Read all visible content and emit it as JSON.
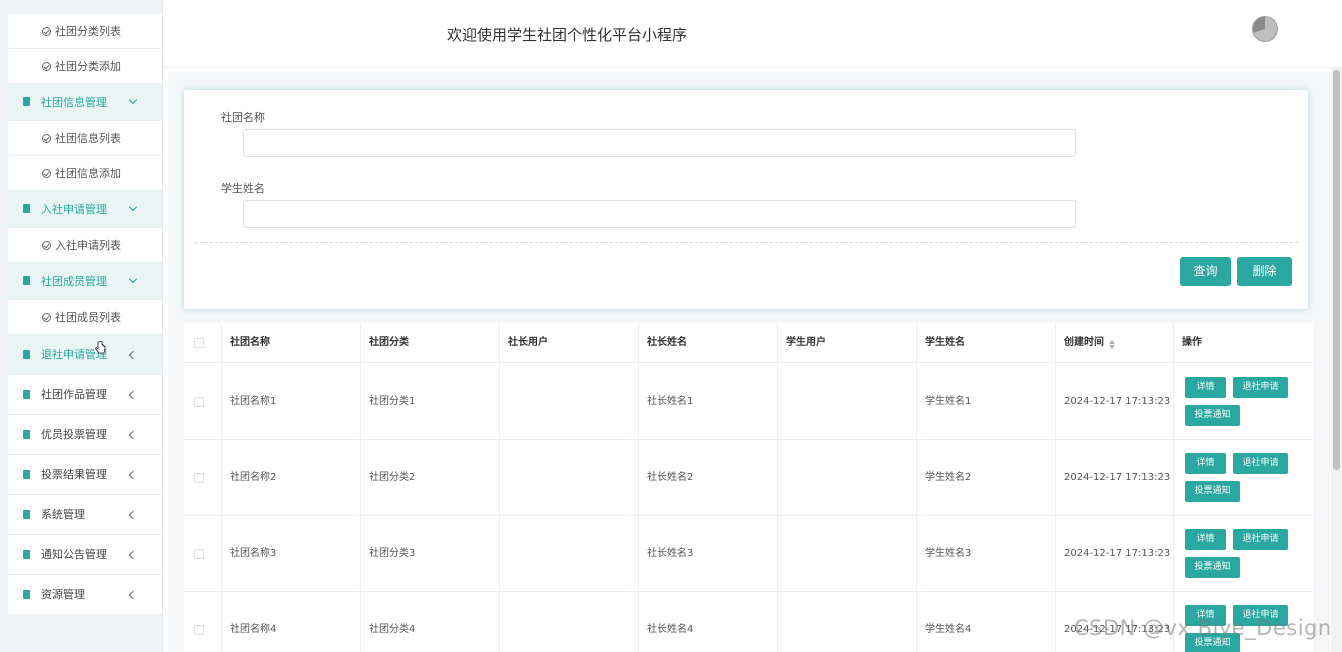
{
  "sidebar": {
    "items": [
      {
        "type": "sub",
        "label": "社团分类列表"
      },
      {
        "type": "sub",
        "label": "社团分类添加"
      },
      {
        "type": "group",
        "label": "社团信息管理",
        "state": "expanded"
      },
      {
        "type": "sub",
        "label": "社团信息列表"
      },
      {
        "type": "sub",
        "label": "社团信息添加"
      },
      {
        "type": "group",
        "label": "入社申请管理",
        "state": "expanded"
      },
      {
        "type": "sub",
        "label": "入社申请列表"
      },
      {
        "type": "group",
        "label": "社团成员管理",
        "state": "expanded"
      },
      {
        "type": "sub",
        "label": "社团成员列表"
      },
      {
        "type": "group",
        "label": "退社申请管理",
        "state": "collapsed-hover"
      },
      {
        "type": "group",
        "label": "社团作品管理",
        "state": "collapsed"
      },
      {
        "type": "group",
        "label": "优员投票管理",
        "state": "collapsed"
      },
      {
        "type": "group",
        "label": "投票结果管理",
        "state": "collapsed"
      },
      {
        "type": "group",
        "label": "系统管理",
        "state": "collapsed"
      },
      {
        "type": "group",
        "label": "通知公告管理",
        "state": "collapsed"
      },
      {
        "type": "group",
        "label": "资源管理",
        "state": "collapsed"
      }
    ]
  },
  "header": {
    "title": "欢迎使用学生社团个性化平台小程序"
  },
  "search": {
    "club_name_label": "社团名称",
    "club_name_value": "",
    "student_name_label": "学生姓名",
    "student_name_value": "",
    "query_label": "查询",
    "delete_label": "删除"
  },
  "table": {
    "headers": [
      "社团名称",
      "社团分类",
      "社长用户",
      "社长姓名",
      "学生用户",
      "学生姓名",
      "创建时间",
      "操作"
    ],
    "rows": [
      {
        "club_name": "社团名称1",
        "category": "社团分类1",
        "leader_user": "",
        "leader_name": "社长姓名1",
        "student_user": "",
        "student_name": "学生姓名1",
        "created": "2024-12-17 17:13:23"
      },
      {
        "club_name": "社团名称2",
        "category": "社团分类2",
        "leader_user": "",
        "leader_name": "社长姓名2",
        "student_user": "",
        "student_name": "学生姓名2",
        "created": "2024-12-17 17:13:23"
      },
      {
        "club_name": "社团名称3",
        "category": "社团分类3",
        "leader_user": "",
        "leader_name": "社长姓名3",
        "student_user": "",
        "student_name": "学生姓名3",
        "created": "2024-12-17 17:13:23"
      },
      {
        "club_name": "社团名称4",
        "category": "社团分类4",
        "leader_user": "",
        "leader_name": "社长姓名4",
        "student_user": "",
        "student_name": "学生姓名4",
        "created": "2024-12-17 17:13:23"
      }
    ],
    "actions": {
      "detail": "详情",
      "quit": "退社申请",
      "vote_notice": "投票通知"
    }
  },
  "watermark": "CSDN @vx Biye_Design",
  "colors": {
    "accent": "#2aa7a1",
    "sidebar_bg": "#f0f3f5",
    "main_bg": "#f4f6f8"
  }
}
